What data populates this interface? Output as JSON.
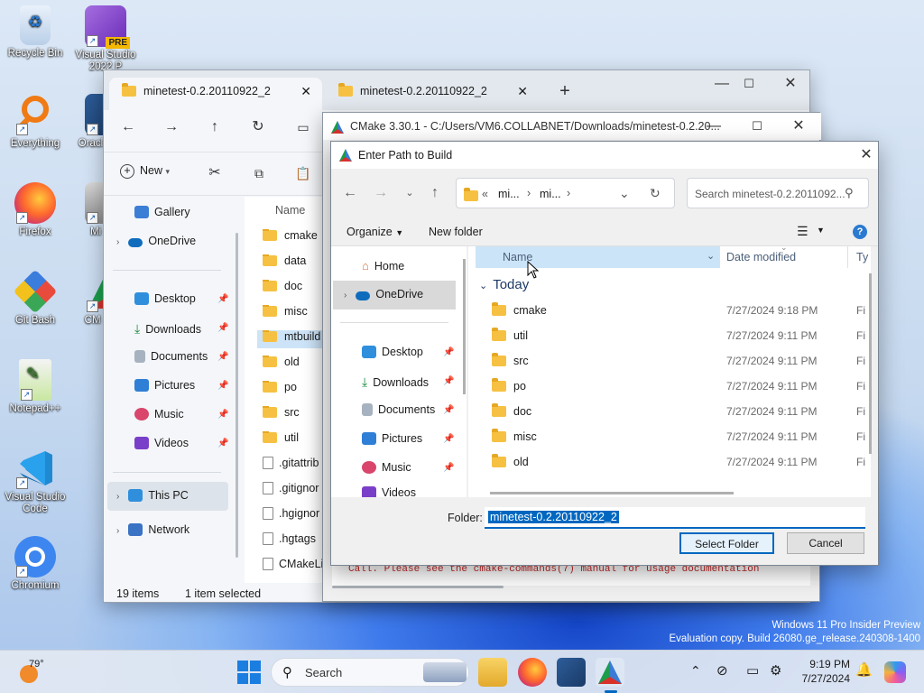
{
  "desktop_icons": [
    {
      "label": "Recycle Bin",
      "icon": "recycle-bin-icon"
    },
    {
      "label": "Visual Studio 2022 P",
      "icon": "visual-studio-icon",
      "badge": "PRE"
    },
    {
      "label": "Everything",
      "icon": "everything-search-icon"
    },
    {
      "label": "Oracle Virtu",
      "icon": "virtualbox-icon"
    },
    {
      "label": "Firefox",
      "icon": "firefox-icon"
    },
    {
      "label": "Mi Inst",
      "icon": "installer-icon"
    },
    {
      "label": "Git Bash",
      "icon": "git-bash-icon"
    },
    {
      "label": "CM (cma",
      "icon": "cmake-icon"
    },
    {
      "label": "Notepad++",
      "icon": "notepadpp-icon"
    },
    {
      "label": "Visual Studio Code",
      "icon": "vscode-icon"
    },
    {
      "label": "Chromium",
      "icon": "chromium-icon"
    }
  ],
  "explorer": {
    "tabs": [
      {
        "label": "minetest-0.2.20110922_2"
      },
      {
        "label": "minetest-0.2.20110922_2"
      }
    ],
    "toolbar": {
      "new_label": "New"
    },
    "nav": [
      "Gallery",
      "OneDrive",
      "Desktop",
      "Downloads",
      "Documents",
      "Pictures",
      "Music",
      "Videos",
      "This PC",
      "Network"
    ],
    "column_name": "Name",
    "files": [
      "cmake",
      "data",
      "doc",
      "misc",
      "mtbuild",
      "old",
      "po",
      "src",
      "util",
      ".gitattrib",
      ".gitignor",
      ".hgignor",
      ".hgtags",
      "CMakeLi"
    ],
    "status_items": "19 items",
    "status_selected": "1 item selected"
  },
  "cmake": {
    "title": "CMake 3.30.1 - C:/Users/VM6.COLLABNET/Downloads/minetest-0.2.20...",
    "log_text": "Call.  Please see the cmake-commands(7) manual for usage documentation"
  },
  "dialog": {
    "title": "Enter Path to Build",
    "breadcrumb": [
      "mi...",
      "mi..."
    ],
    "search_placeholder": "Search minetest-0.2.2011092...",
    "organize_label": "Organize",
    "new_folder_label": "New folder",
    "nav": [
      "Home",
      "OneDrive",
      "Desktop",
      "Downloads",
      "Documents",
      "Pictures",
      "Music",
      "Videos"
    ],
    "columns": {
      "name": "Name",
      "date": "Date modified",
      "type": "Ty"
    },
    "group": "Today",
    "rows": [
      {
        "name": "cmake",
        "date": "7/27/2024 9:18 PM",
        "type": "Fi"
      },
      {
        "name": "util",
        "date": "7/27/2024 9:11 PM",
        "type": "Fi"
      },
      {
        "name": "src",
        "date": "7/27/2024 9:11 PM",
        "type": "Fi"
      },
      {
        "name": "po",
        "date": "7/27/2024 9:11 PM",
        "type": "Fi"
      },
      {
        "name": "doc",
        "date": "7/27/2024 9:11 PM",
        "type": "Fi"
      },
      {
        "name": "misc",
        "date": "7/27/2024 9:11 PM",
        "type": "Fi"
      },
      {
        "name": "old",
        "date": "7/27/2024 9:11 PM",
        "type": "Fi"
      }
    ],
    "folder_label": "Folder:",
    "folder_value": "minetest-0.2.20110922_2",
    "select_label": "Select Folder",
    "cancel_label": "Cancel"
  },
  "watermark": {
    "line1": "Windows 11 Pro Insider Preview",
    "line2": "Evaluation copy. Build 26080.ge_release.240308-1400"
  },
  "taskbar": {
    "weather": "79°",
    "search_label": "Search",
    "time": "9:19 PM",
    "date": "7/27/2024"
  },
  "colors": {
    "accent": "#0067c0",
    "selection": "#cce4f7",
    "folder": "#f6c142"
  }
}
